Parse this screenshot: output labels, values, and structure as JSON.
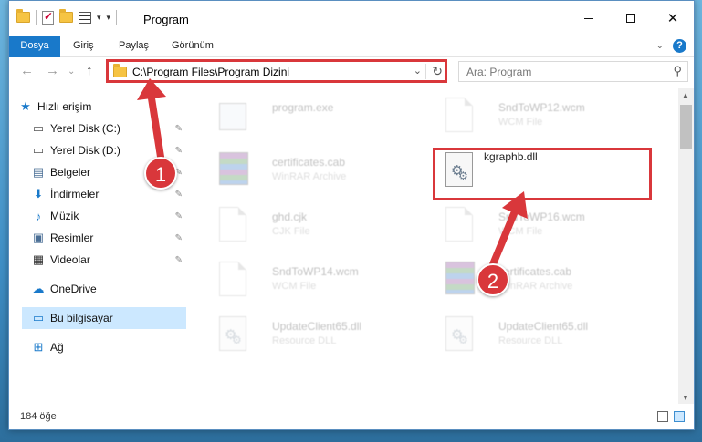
{
  "window": {
    "title": "Program",
    "controls": {
      "minimize": "–",
      "maximize": "□",
      "close": "✕"
    }
  },
  "ribbon": {
    "tabs": [
      "Dosya",
      "Giriş",
      "Paylaş",
      "Görünüm"
    ],
    "expand": "⌄",
    "help": "?"
  },
  "nav": {
    "back": "←",
    "forward": "→",
    "recent": "⌄",
    "up": "↑",
    "address_path": "C:\\Program Files\\Program Dizini",
    "address_dropdown": "⌄",
    "refresh": "↻",
    "search_placeholder": "Ara: Program",
    "search_icon": "⚲"
  },
  "sidebar": {
    "items": [
      {
        "label": "Hızlı erişim",
        "icon": "star-icon",
        "glyph": "★",
        "pinned": false
      },
      {
        "label": "Yerel Disk (C:)",
        "icon": "drive-icon",
        "glyph": "▭",
        "pinned": true
      },
      {
        "label": "Yerel Disk (D:)",
        "icon": "drive-icon",
        "glyph": "▭",
        "pinned": true
      },
      {
        "label": "Belgeler",
        "icon": "documents-icon",
        "glyph": "▤",
        "pinned": true
      },
      {
        "label": "İndirmeler",
        "icon": "download-icon",
        "glyph": "⬇",
        "pinned": true
      },
      {
        "label": "Müzik",
        "icon": "music-icon",
        "glyph": "♪",
        "pinned": true
      },
      {
        "label": "Resimler",
        "icon": "pictures-icon",
        "glyph": "▣",
        "pinned": true
      },
      {
        "label": "Videolar",
        "icon": "video-icon",
        "glyph": "▦",
        "pinned": true
      },
      {
        "label": "OneDrive",
        "icon": "cloud-icon",
        "glyph": "☁",
        "pinned": false
      },
      {
        "label": "Bu bilgisayar",
        "icon": "computer-icon",
        "glyph": "▭",
        "pinned": false
      },
      {
        "label": "Ağ",
        "icon": "network-icon",
        "glyph": "⊞",
        "pinned": false
      }
    ],
    "pin_glyph": "📌"
  },
  "files": [
    {
      "name": "program.exe",
      "type": "",
      "icon": "exe-icon",
      "faded": true
    },
    {
      "name": "SndToWP12.wcm",
      "type": "WCM File",
      "icon": "document-icon",
      "faded": true
    },
    {
      "name": "certificates.cab",
      "type": "WinRAR Archive",
      "icon": "winrar-icon",
      "faded": true
    },
    {
      "name": "kgraphb.dll",
      "type": "",
      "icon": "dll-gears-icon",
      "faded": false
    },
    {
      "name": "ghd.cjk",
      "type": "CJK File",
      "icon": "document-icon",
      "faded": true
    },
    {
      "name": "SndToWP16.wcm",
      "type": "WCM File",
      "icon": "document-icon",
      "faded": true
    },
    {
      "name": "SndToWP14.wcm",
      "type": "WCM File",
      "icon": "document-icon",
      "faded": true
    },
    {
      "name": "certificates.cab",
      "type": "WinRAR Archive",
      "icon": "winrar-icon",
      "faded": true
    },
    {
      "name": "UpdateClient65.dll",
      "type": "Resource DLL",
      "icon": "dll-gears-icon",
      "faded": true
    },
    {
      "name": "UpdateClient65.dll",
      "type": "Resource DLL",
      "icon": "dll-gears-icon",
      "faded": true
    }
  ],
  "status": {
    "item_count": "184 öğe"
  },
  "annotations": {
    "step1": "1",
    "step2": "2",
    "color": "#d9373b"
  }
}
